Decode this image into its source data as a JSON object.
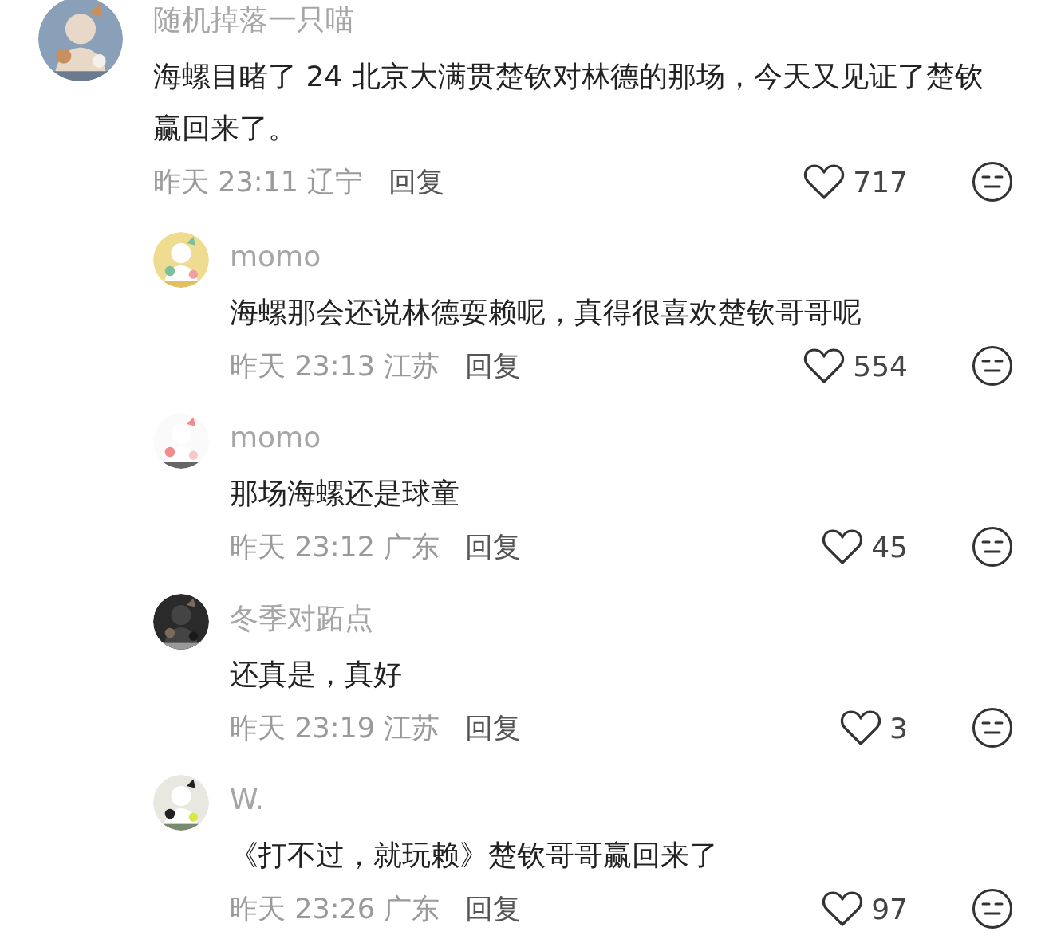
{
  "comments": [
    {
      "kind": "top",
      "username": "随机掉落一只喵",
      "text": "海螺目睹了 24 北京大满贯楚钦对林德的那场，今天又见证了楚钦赢回来了。",
      "meta": "昨天 23:11 辽宁",
      "reply": "回复",
      "likes": "717"
    },
    {
      "kind": "reply",
      "username": "momo",
      "text": "海螺那会还说林德耍赖呢，真得很喜欢楚钦哥哥呢",
      "meta": "昨天 23:13 江苏",
      "reply": "回复",
      "likes": "554"
    },
    {
      "kind": "reply",
      "username": "momo",
      "text": "那场海螺还是球童",
      "meta": "昨天 23:12 广东",
      "reply": "回复",
      "likes": "45"
    },
    {
      "kind": "reply",
      "username": "冬季对跖点",
      "text": "还真是，真好",
      "meta": "昨天 23:19 江苏",
      "reply": "回复",
      "likes": "3"
    },
    {
      "kind": "reply",
      "username": "W.",
      "text": "《打不过，就玩赖》楚钦哥哥赢回来了",
      "meta": "昨天 23:26 广东",
      "reply": "回复",
      "likes": "97"
    }
  ]
}
